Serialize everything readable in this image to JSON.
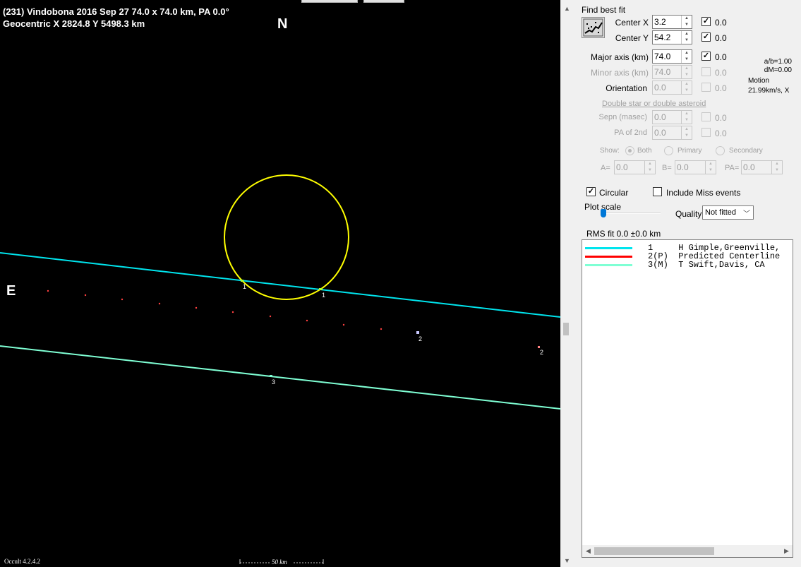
{
  "plot": {
    "title_line1": "(231) Vindobona  2016 Sep 27  74.0 x 74.0 km, PA 0.0°",
    "title_line2": "Geocentric  X  2824.8  Y 5498.3 km",
    "north_label": "N",
    "east_label": "E",
    "version": "Occult 4.2.4.2",
    "scale_label": "50 km",
    "colors": {
      "background": "#000000",
      "asteroid_outline": "#ffff00",
      "chord_1": "#00e5ee",
      "chord_3": "#7fffd4",
      "predicted_dots": "#ff4040",
      "marker_text": "#ffffff"
    },
    "markers": [
      {
        "id": "marker-1a",
        "label": "1"
      },
      {
        "id": "marker-1b",
        "label": "1"
      },
      {
        "id": "marker-2a",
        "label": "2"
      },
      {
        "id": "marker-2b",
        "label": "2"
      },
      {
        "id": "marker-3",
        "label": "3"
      }
    ]
  },
  "panel": {
    "find_best_fit_label": "Find best fit",
    "fields": {
      "center_x": {
        "label": "Center X",
        "value": "3.2",
        "check_value": "0.0",
        "checked": true
      },
      "center_y": {
        "label": "Center Y",
        "value": "54.2",
        "check_value": "0.0",
        "checked": true
      },
      "major_axis": {
        "label": "Major axis (km)",
        "value": "74.0",
        "check_value": "0.0",
        "checked": true
      },
      "minor_axis": {
        "label": "Minor axis (km)",
        "value": "74.0",
        "check_value": "0.0",
        "checked": false
      },
      "orientation": {
        "label": "Orientation",
        "value": "0.0",
        "check_value": "0.0",
        "checked": false
      }
    },
    "ratio_ab": "a/b=1.00",
    "dm": "dM=0.00",
    "motion_label": "Motion",
    "motion_value": "21.99km/s, X",
    "double_star_label": "Double star  or  double asteroid",
    "sepn": {
      "label": "Sepn (masec)",
      "value": "0.0",
      "check_value": "0.0"
    },
    "pa_2nd": {
      "label": "PA of 2nd",
      "value": "0.0",
      "check_value": "0.0"
    },
    "show_label": "Show:",
    "show_options": [
      "Both",
      "Primary",
      "Secondary"
    ],
    "a_label": "A=",
    "a_value": "0.0",
    "b_label": "B=",
    "b_value": "0.0",
    "pa_label": "PA=",
    "pa_value": "0.0",
    "circular_label": "Circular",
    "circular_checked": true,
    "include_miss_label": "Include Miss events",
    "include_miss_checked": false,
    "plot_scale_label": "Plot scale",
    "quality_label": "Quality",
    "quality_value": "Not fitted",
    "rms_label": "RMS fit 0.0 ±0.0 km",
    "observers": [
      {
        "num": "1",
        "text": "1     H Gimple,Greenville,",
        "color": "#00e5ee"
      },
      {
        "num": "2",
        "text": "2(P)  Predicted Centerline",
        "color": "#ff0000"
      },
      {
        "num": "3",
        "text": "3(M)  T Swift,Davis, CA",
        "color": "#7fffd4"
      }
    ]
  }
}
